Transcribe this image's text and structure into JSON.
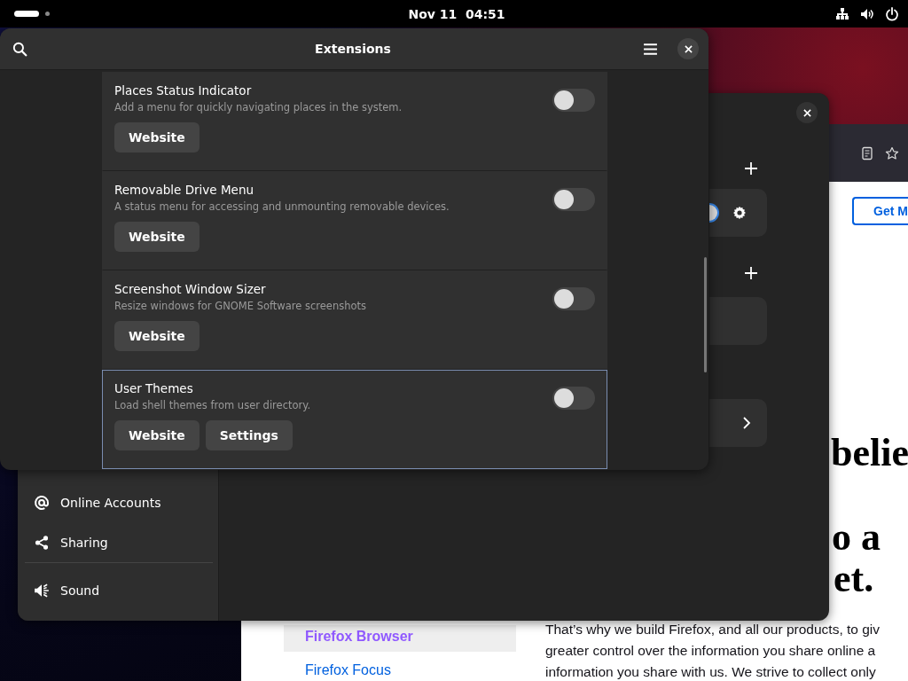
{
  "top_bar": {
    "clock": "Nov 11  04:51"
  },
  "extensions_window": {
    "title": "Extensions",
    "extensions": [
      {
        "name": "Places Status Indicator",
        "description": "Add a menu for quickly navigating places in the system.",
        "enabled": false,
        "focused": false,
        "buttons": [
          "Website"
        ]
      },
      {
        "name": "Removable Drive Menu",
        "description": "A status menu for accessing and unmounting removable devices.",
        "enabled": false,
        "focused": false,
        "buttons": [
          "Website"
        ]
      },
      {
        "name": "Screenshot Window Sizer",
        "description": "Resize windows for GNOME Software screenshots",
        "enabled": false,
        "focused": false,
        "buttons": [
          "Website"
        ]
      },
      {
        "name": "User Themes",
        "description": "Load shell themes from user directory.",
        "enabled": false,
        "focused": true,
        "buttons": [
          "Website",
          "Settings"
        ]
      }
    ]
  },
  "settings_window": {
    "sidebar": {
      "items": [
        {
          "label": "Online Accounts",
          "kind": "at",
          "separator_after": false
        },
        {
          "label": "Sharing",
          "kind": "share",
          "separator_after": true
        },
        {
          "label": "Sound",
          "kind": "sound",
          "separator_after": false
        }
      ]
    }
  },
  "browser_window": {
    "header_button": "Get M",
    "heading_lines": [
      "belie",
      "o a",
      "et."
    ],
    "nav_links": [
      {
        "label": "Firefox Browser",
        "selected": true
      },
      {
        "label": "Firefox Focus",
        "selected": false
      }
    ],
    "paragraph_lines": [
      "That’s why we build Firefox, and all our products, to giv",
      "greater control over the information you share online a",
      "information you share with us. We strive to collect only"
    ]
  }
}
